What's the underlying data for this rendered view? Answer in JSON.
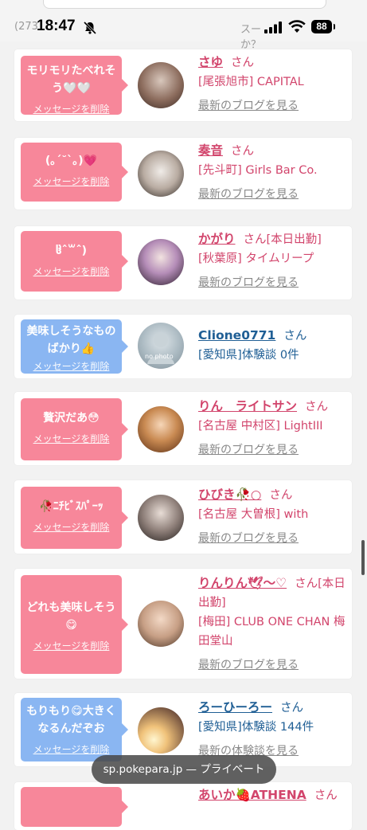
{
  "status": {
    "time": "18:47",
    "battery": "88",
    "behind_left": "(273",
    "behind_right": "スー　　　　　　　　　　か？"
  },
  "rows": [
    {
      "message": "モリモリたべれそう🤍🤍",
      "delete": "メッセージを削除",
      "name": "さゆ",
      "san": "さん",
      "shop": "[尾張旭市] CAPITAL",
      "blog": "最新のブログを見る"
    },
    {
      "message": "(｡ˊ˘ˋ｡)💗",
      "delete": "メッセージを削除",
      "name": "奏音",
      "san": "さん",
      "shop": "[先斗町] Girls Bar Co.",
      "blog": "最新のブログを見る"
    },
    {
      "message": "ჱ̒ˆ꒳ˆ)",
      "delete": "メッセージを削除",
      "name": "かがり",
      "san": "さん[本日出勤]",
      "shop": "[秋葉原] タイムリープ",
      "blog": "最新のブログを見る"
    },
    {
      "message": "美味しそうなものばかり👍",
      "delete": "メッセージを削除",
      "name": "Clione0771",
      "san": "さん",
      "shop": "[愛知県]体験談 0件",
      "blog": "",
      "avatar_text": "no photo"
    },
    {
      "message": "贅沢だあ😳",
      "delete": "メッセージを削除",
      "name": "りん　ライトサン",
      "san": "さん",
      "shop": "[名古屋 中村区] LightIII",
      "blog": "最新のブログを見る"
    },
    {
      "message": "🥀ﾆﾁﾋﾞｽﾊﾟｰｯ",
      "delete": "メッセージを削除",
      "name": "ひびき🥀○",
      "san": "さん",
      "shop": "[名古屋 大曽根] with",
      "blog": "最新のブログを見る"
    },
    {
      "message": "どれも美味しそう😋",
      "delete": "メッセージを削除",
      "name": "りんりん🕊〜♡",
      "san": "さん[本日出勤]",
      "shop": "[梅田] CLUB ONE CHAN 梅田堂山",
      "blog": "最新のブログを見る"
    },
    {
      "message": "もりもり😋大きくなるんだぞお",
      "delete": "メッセージを削除",
      "name": "ろーひーろー",
      "san": "さん",
      "shop": "[愛知県]体験談 144件",
      "blog": "最新の体験談を見る"
    },
    {
      "message": "",
      "delete": "",
      "name": "あいか🍓ATHENA",
      "san": "さん",
      "shop": "",
      "blog": ""
    }
  ],
  "browser": {
    "site": "sp.pokepara.jp — プライベート"
  },
  "colors": {
    "pink_bubble": "#f7879a",
    "blue_bubble": "#8ab6f2",
    "cast_name": "#d2456c",
    "user_name": "#205f95"
  }
}
